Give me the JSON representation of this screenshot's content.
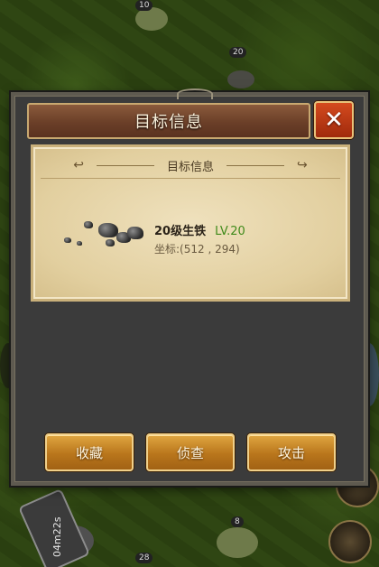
{
  "dialog": {
    "title": "目标信息",
    "subtitle": "目标信息",
    "target": {
      "name": "20级生铁",
      "level": "LV.20",
      "coords_label": "坐标:",
      "coords_value": "(512 , 294)"
    },
    "buttons": {
      "favorite": "收藏",
      "scout": "侦查",
      "attack": "攻击"
    }
  },
  "map": {
    "tags": [
      "10",
      "20",
      "28",
      "8"
    ],
    "timer": "04m22s"
  },
  "colors": {
    "header": "#6b3f28",
    "close": "#c03a12",
    "button": "#c4821e",
    "level": "#3f8a1a",
    "panel": "#e6d4a6"
  }
}
